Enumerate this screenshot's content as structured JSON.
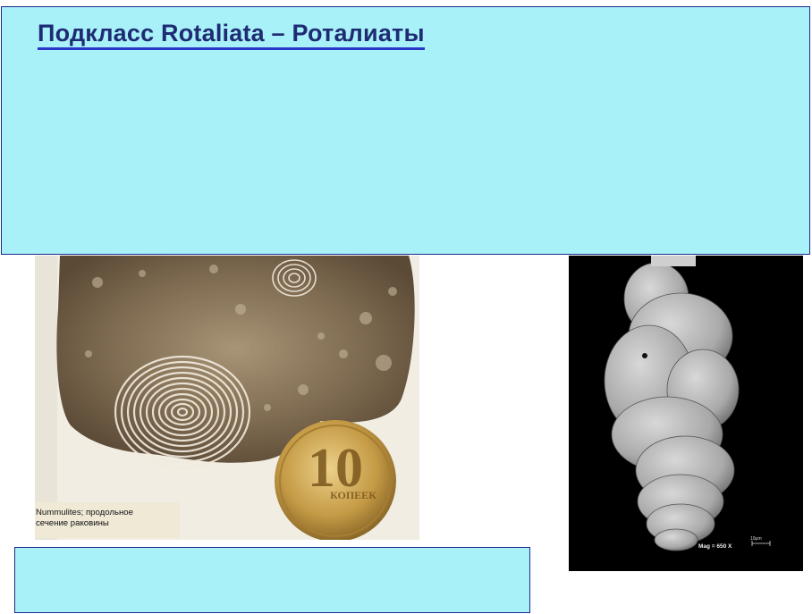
{
  "title": "Подкласс Rotaliata – Роталиаты",
  "left_photo": {
    "caption_line1": "Nummulites; продольное",
    "caption_line2": "сечение раковины",
    "coin_value": "10",
    "coin_text": "КОПЕЕК"
  },
  "right_photo": {
    "mag_label": "Mag =   650 X",
    "scale_label": "10μm"
  },
  "colors": {
    "panel_bg": "#a8f1f8",
    "panel_border": "#1b2a8a",
    "title_text": "#1f2b73"
  }
}
